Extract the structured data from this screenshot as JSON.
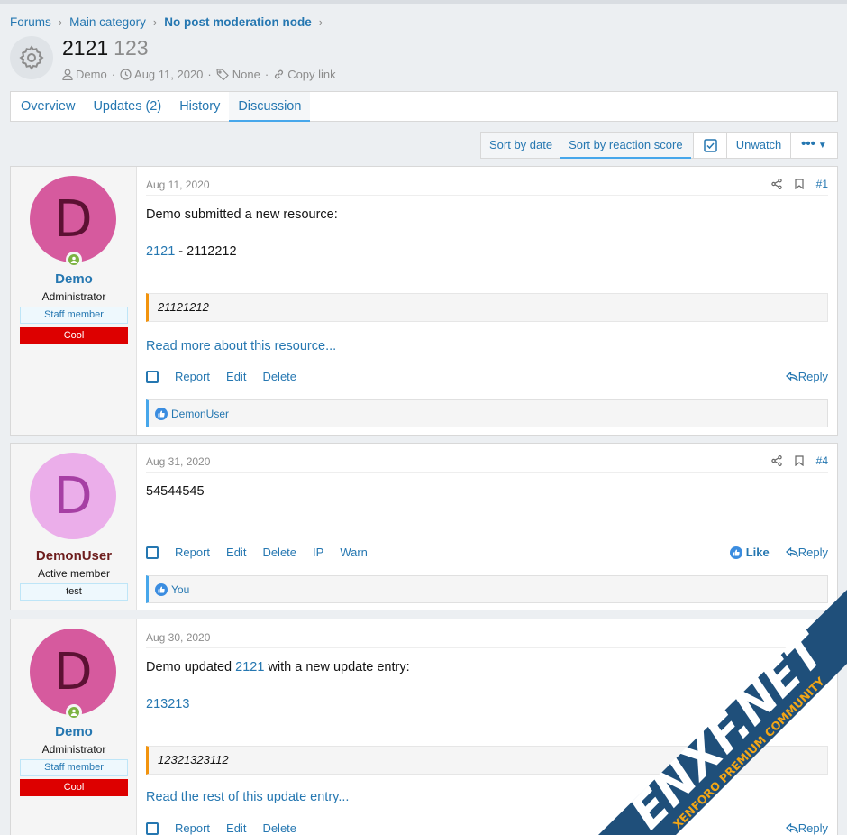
{
  "breadcrumb": {
    "items": [
      "Forums",
      "Main category",
      "No post moderation node"
    ]
  },
  "header": {
    "title": "2121",
    "subtitle": "123",
    "author": "Demo",
    "date": "Aug 11, 2020",
    "tags": "None",
    "copy_link": "Copy link"
  },
  "tabs": [
    "Overview",
    "Updates (2)",
    "History",
    "Discussion"
  ],
  "sort": {
    "by_date": "Sort by date",
    "by_reaction": "Sort by reaction score",
    "unwatch": "Unwatch",
    "more": "•••"
  },
  "posts": [
    {
      "date": "Aug 11, 2020",
      "number": "#1",
      "user": {
        "initial": "D",
        "name": "Demo",
        "title": "Administrator",
        "banner": "Staff member",
        "banner2": "Cool"
      },
      "text1": "Demo submitted a new resource:",
      "link": "2121",
      "text2": " - 2112212",
      "quote": "21121212",
      "read_more": "Read more about this resource...",
      "actions": [
        "Report",
        "Edit",
        "Delete"
      ],
      "reply": "Reply",
      "reaction_user": "DemonUser"
    },
    {
      "date": "Aug 31, 2020",
      "number": "#4",
      "user": {
        "initial": "D",
        "name": "DemonUser",
        "title": "Active member",
        "banner": "test"
      },
      "text1": "54544545",
      "actions": [
        "Report",
        "Edit",
        "Delete",
        "IP",
        "Warn"
      ],
      "like": "Like",
      "reply": "Reply",
      "reaction_user": "You"
    },
    {
      "date": "Aug 30, 2020",
      "user": {
        "initial": "D",
        "name": "Demo",
        "title": "Administrator",
        "banner": "Staff member",
        "banner2": "Cool"
      },
      "text_pre": "Demo updated ",
      "link": "2121",
      "text_post": " with a new update entry:",
      "update_title": "213213",
      "quote": "12321323112",
      "read_more": "Read the rest of this update entry...",
      "actions": [
        "Report",
        "Edit",
        "Delete"
      ],
      "reply": "Reply"
    }
  ],
  "colors": {
    "link": "#2577b1",
    "avatar_demo": "#d65a9e",
    "avatar_demonuser": "#ebaeea",
    "red_banner": "#dd0000"
  },
  "watermark": {
    "brand": "ENXF.NET",
    "tagline": "XENFORO PREMIUM COMMUNITY"
  }
}
